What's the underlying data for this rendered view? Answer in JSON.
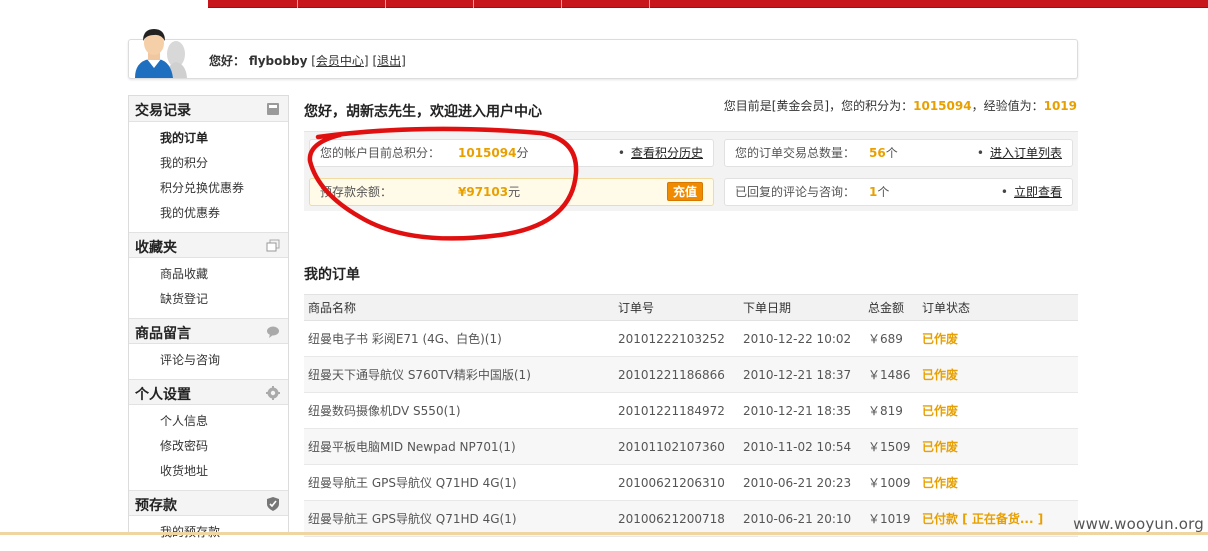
{
  "userbar": {
    "greeting_label": "您好：",
    "username": "flybobby",
    "member_center": "[会员中心]",
    "logout": "[退出]"
  },
  "sidebar": {
    "sections": [
      {
        "title": "交易记录",
        "icon": "box-icon",
        "items": [
          "我的订单",
          "我的积分",
          "积分兑换优惠券",
          "我的优惠券"
        ]
      },
      {
        "title": "收藏夹",
        "icon": "folders-icon",
        "items": [
          "商品收藏",
          "缺货登记"
        ]
      },
      {
        "title": "商品留言",
        "icon": "chat-bubble-icon",
        "items": [
          "评论与咨询"
        ]
      },
      {
        "title": "个人设置",
        "icon": "gear-icon",
        "items": [
          "个人信息",
          "修改密码",
          "收货地址"
        ]
      },
      {
        "title": "预存款",
        "icon": "shield-check-icon",
        "items": [
          "我的预存款"
        ]
      }
    ]
  },
  "main": {
    "welcome": "您好，胡新志先生，欢迎进入用户中心",
    "points_line": {
      "prefix": "您目前是[黄金会员]，您的积分为：",
      "points": "1015094",
      "middle": "，经验值为：",
      "exp": "1019"
    },
    "summary": {
      "points_box": {
        "label": "您的帐户目前总积分：",
        "value": "1015094",
        "unit": "分",
        "action": "查看积分历史"
      },
      "orders_box": {
        "label": "您的订单交易总数量：",
        "value": "56",
        "unit": "个",
        "action": "进入订单列表"
      },
      "deposit_box": {
        "label": "预存款余额：",
        "value": "¥97103",
        "unit": "元",
        "action": "充值"
      },
      "reviews_box": {
        "label": "已回复的评论与咨询：",
        "value": "1",
        "unit": "个",
        "action": "立即查看"
      }
    },
    "orders_title": "我的订单",
    "orders": {
      "columns": [
        "商品名称",
        "订单号",
        "下单日期",
        "总金额",
        "订单状态"
      ],
      "rows": [
        {
          "name": "纽曼电子书 彩阅E71 (4G、白色)(1)",
          "id": "20101222103252",
          "date": "2010-12-22 10:02",
          "amount": "￥689",
          "status": "已作废"
        },
        {
          "name": "纽曼天下通导航仪 S760TV精彩中国版(1)",
          "id": "20101221186866",
          "date": "2010-12-21 18:37",
          "amount": "￥1486",
          "status": "已作废"
        },
        {
          "name": "纽曼数码摄像机DV S550(1)",
          "id": "20101221184972",
          "date": "2010-12-21 18:35",
          "amount": "￥819",
          "status": "已作废"
        },
        {
          "name": "纽曼平板电脑MID Newpad NP701(1)",
          "id": "20101102107360",
          "date": "2010-11-02 10:54",
          "amount": "￥1509",
          "status": "已作废"
        },
        {
          "name": "纽曼导航王 GPS导航仪 Q71HD 4G(1)",
          "id": "20100621206310",
          "date": "2010-06-21 20:23",
          "amount": "￥1009",
          "status": "已作废"
        },
        {
          "name": "纽曼导航王 GPS导航仪 Q71HD 4G(1)",
          "id": "20100621200718",
          "date": "2010-06-21 20:10",
          "amount": "￥1019",
          "status": "已付款 [ 正在备货... ]"
        }
      ]
    }
  },
  "watermark": "www.wooyun.org",
  "colors": {
    "accent_orange": "#e8a000",
    "topbar_red": "#c8161d",
    "annotation_red": "#e01010"
  }
}
